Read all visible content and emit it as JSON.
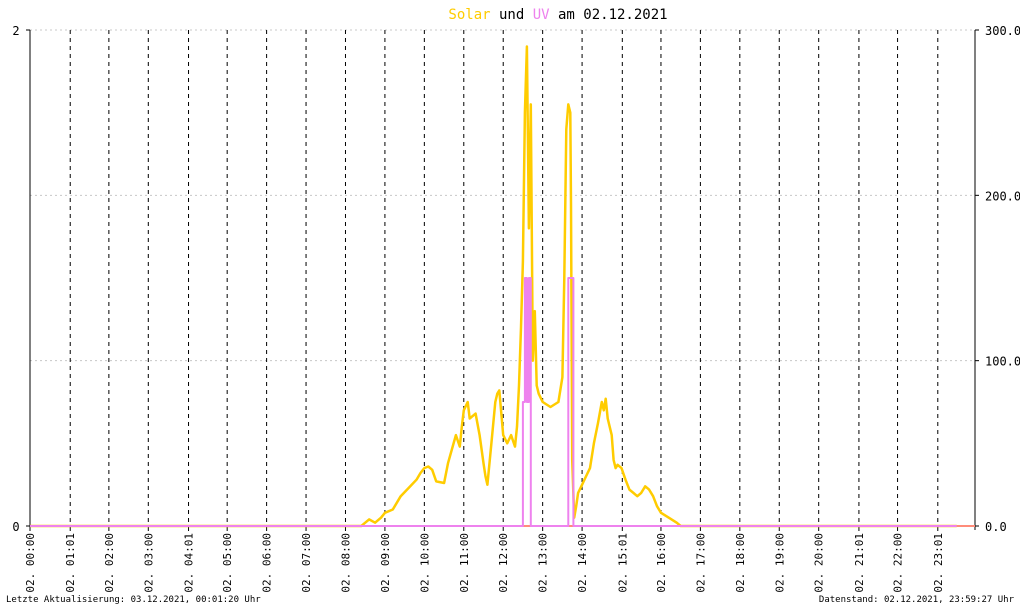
{
  "title": {
    "part_solar": "Solar",
    "part_und": " und ",
    "part_uv": "UV",
    "part_date": " am 02.12.2021"
  },
  "colors": {
    "solar": "#ffcc00",
    "uv": "#ee82ee",
    "baseline": "#ff8c7a",
    "grid_vertical": "#000000",
    "grid_horizontal": "#c8c8c8",
    "axis": "#000000",
    "background": "#ffffff"
  },
  "footer": {
    "left": "Letzte Aktualisierung: 03.12.2021, 00:01:20 Uhr",
    "right": "Datenstand: 02.12.2021, 23:59:27 Uhr"
  },
  "chart_data": {
    "type": "line",
    "x_unit": "hours",
    "xlim": [
      0,
      23.5
    ],
    "left_axis": {
      "ticks": [
        "0",
        "2"
      ],
      "range": [
        0,
        2
      ]
    },
    "right_axis": {
      "ticks": [
        "0.0",
        "100.0",
        "200.0",
        "300.0"
      ],
      "range": [
        0,
        300
      ]
    },
    "x_tick_labels": [
      "02. 00:00",
      "02. 01:01",
      "02. 02:00",
      "02. 03:00",
      "02. 04:01",
      "02. 05:00",
      "02. 06:00",
      "02. 07:00",
      "02. 08:00",
      "02. 09:00",
      "02. 10:00",
      "02. 11:00",
      "02. 12:00",
      "02. 13:00",
      "02. 14:00",
      "02. 15:01",
      "02. 16:00",
      "02. 17:00",
      "02. 18:00",
      "02. 19:00",
      "02. 20:00",
      "02. 21:01",
      "02. 22:00",
      "02. 23:01"
    ],
    "x_tick_positions": [
      0.0,
      1.02,
      2.0,
      3.0,
      4.02,
      5.0,
      6.0,
      7.0,
      8.0,
      9.0,
      10.0,
      11.0,
      12.0,
      13.0,
      14.0,
      15.02,
      16.0,
      17.0,
      18.0,
      19.0,
      20.0,
      21.02,
      22.0,
      23.02
    ],
    "series": [
      {
        "name": "Solar",
        "axis": "right",
        "x": [
          0,
          8.4,
          8.5,
          8.6,
          8.75,
          8.9,
          9.0,
          9.2,
          9.4,
          9.6,
          9.8,
          9.9,
          10.0,
          10.1,
          10.2,
          10.3,
          10.5,
          10.6,
          10.8,
          10.9,
          10.95,
          11.0,
          11.1,
          11.15,
          11.3,
          11.4,
          11.5,
          11.55,
          11.6,
          11.7,
          11.8,
          11.85,
          11.9,
          12.0,
          12.1,
          12.2,
          12.3,
          12.35,
          12.4,
          12.45,
          12.5,
          12.55,
          12.6,
          12.65,
          12.7,
          12.75,
          12.8,
          12.85,
          12.9,
          13.0,
          13.2,
          13.4,
          13.5,
          13.55,
          13.6,
          13.65,
          13.7,
          13.72,
          13.75,
          13.8,
          13.85,
          13.9,
          14.0,
          14.1,
          14.2,
          14.3,
          14.4,
          14.5,
          14.55,
          14.6,
          14.65,
          14.7,
          14.75,
          14.8,
          14.85,
          14.9,
          15.0,
          15.1,
          15.2,
          15.3,
          15.4,
          15.5,
          15.6,
          15.7,
          15.8,
          15.9,
          16.0,
          16.2,
          16.4,
          16.5,
          23.5
        ],
        "values": [
          0,
          0,
          2,
          4,
          2,
          5,
          8,
          10,
          18,
          23,
          28,
          32,
          35,
          36,
          34,
          27,
          26,
          38,
          55,
          48,
          60,
          70,
          75,
          65,
          68,
          55,
          38,
          30,
          25,
          50,
          75,
          80,
          82,
          55,
          50,
          55,
          48,
          60,
          85,
          120,
          160,
          250,
          290,
          180,
          255,
          100,
          130,
          85,
          80,
          75,
          72,
          75,
          90,
          150,
          240,
          255,
          250,
          195,
          40,
          5,
          12,
          20,
          25,
          30,
          35,
          50,
          62,
          75,
          70,
          77,
          65,
          60,
          55,
          40,
          35,
          37,
          35,
          28,
          22,
          20,
          18,
          20,
          24,
          22,
          18,
          12,
          8,
          5,
          2,
          0,
          0
        ]
      },
      {
        "name": "UV",
        "axis": "left",
        "x": [
          0,
          12.5,
          12.5,
          12.55,
          12.55,
          12.6,
          12.6,
          12.65,
          12.65,
          12.7,
          12.7,
          12.75,
          12.75,
          13.65,
          13.65,
          13.78,
          13.78,
          23.5
        ],
        "values": [
          0,
          0,
          0.5,
          0.5,
          1,
          1,
          0.5,
          0.5,
          1,
          1,
          0,
          0,
          0,
          0,
          1,
          1,
          0,
          0
        ]
      }
    ]
  }
}
